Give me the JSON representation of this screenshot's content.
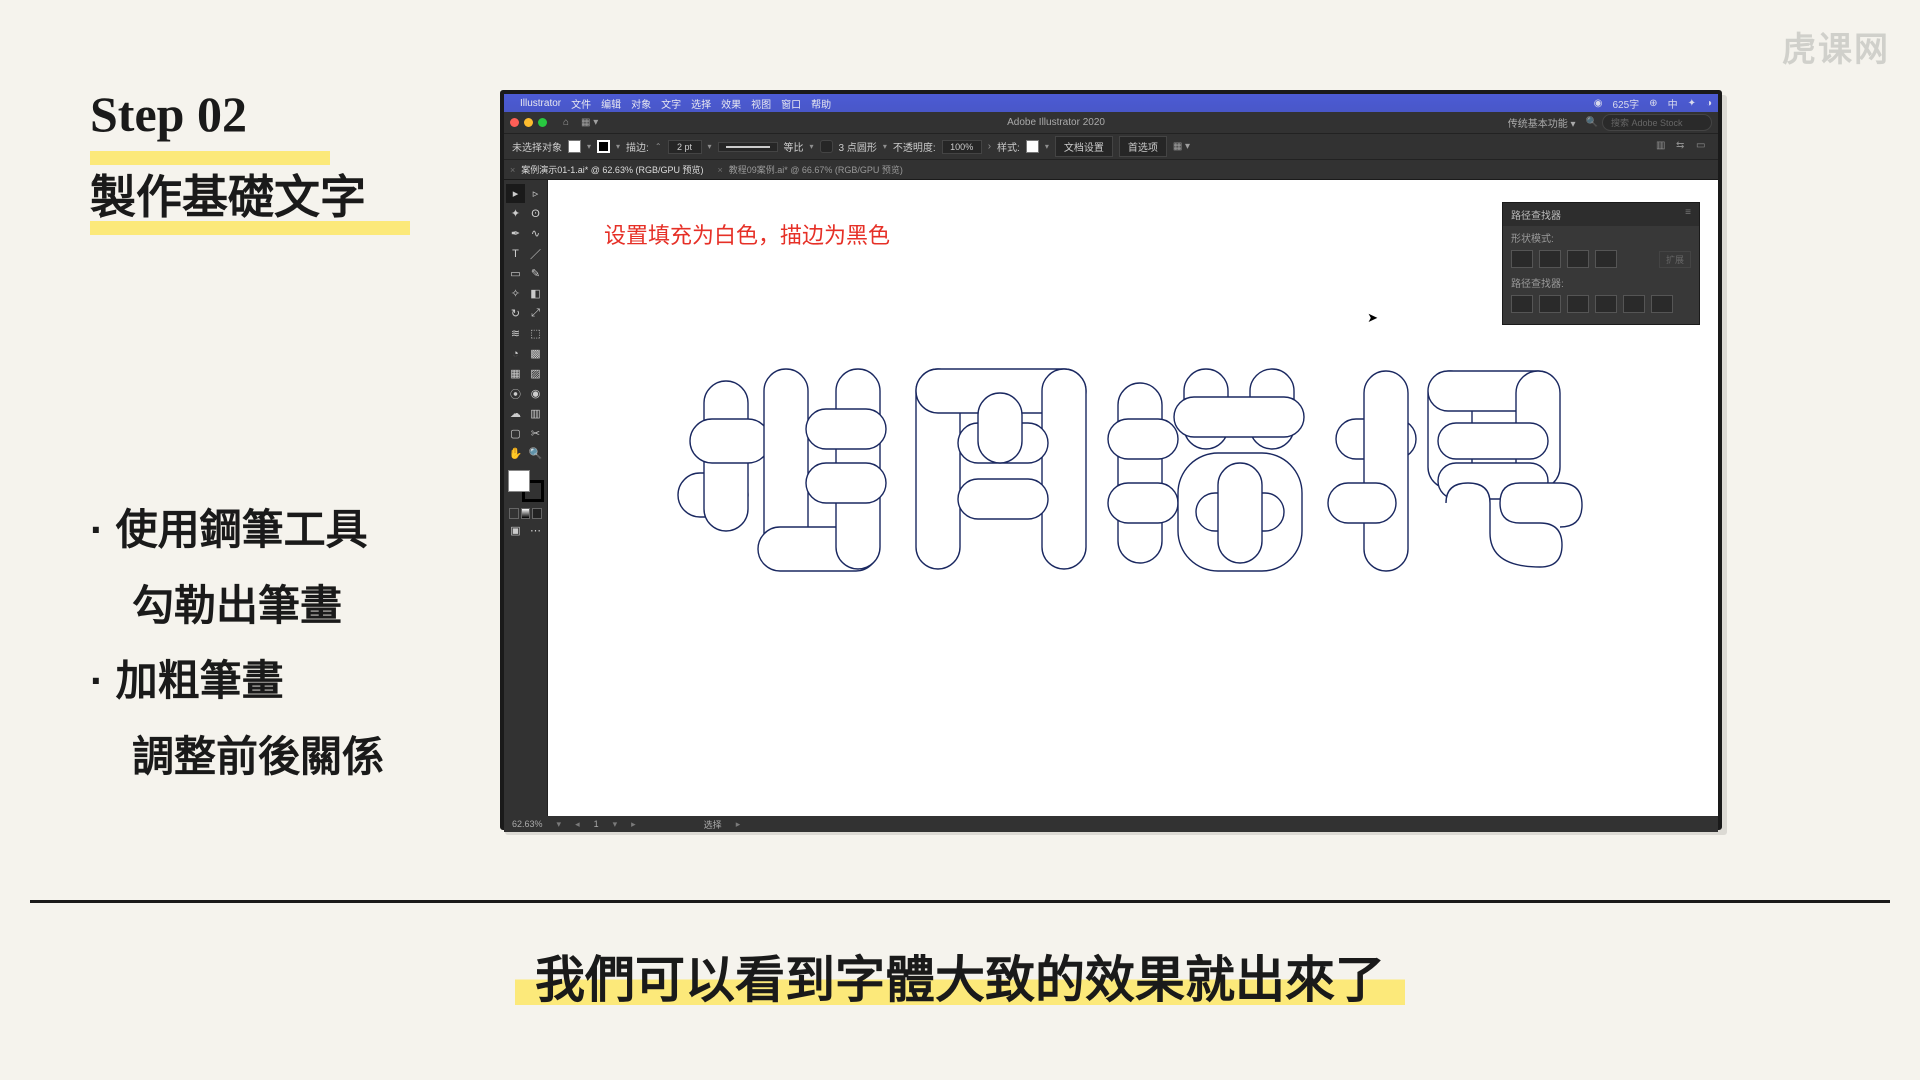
{
  "watermark": "虎课网",
  "step": {
    "num": "Step 02",
    "title": "製作基礎文字"
  },
  "bullets": {
    "b1": "使用鋼筆工具",
    "b1b": "勾勒出筆畫",
    "b2": "加粗筆畫",
    "b2b": "調整前後關係"
  },
  "menubar": {
    "app": "Illustrator",
    "items": [
      "文件",
      "编辑",
      "对象",
      "文字",
      "选择",
      "效果",
      "视图",
      "窗口",
      "帮助"
    ],
    "right_text": "625字"
  },
  "topbar": {
    "title": "Adobe Illustrator 2020",
    "workspace": "传统基本功能",
    "search_ph": "搜索 Adobe Stock"
  },
  "ctrl": {
    "no_sel": "未选择对象",
    "stroke_label": "描边:",
    "stroke_val": "2 pt",
    "uniform": "等比",
    "corner_label": "3 点圆形",
    "opacity_label": "不透明度:",
    "opacity_val": "100%",
    "style_label": "样式:",
    "docsetup": "文档设置",
    "prefs": "首选项"
  },
  "tabs": {
    "t1": "案例演示01-1.ai* @ 62.63% (RGB/GPU 预览)",
    "t2": "教程09案例.ai* @ 66.67% (RGB/GPU 预览)"
  },
  "annotation": "设置填充为白色，描边为黑色",
  "pathfinder": {
    "title": "路径查找器",
    "shape_modes": "形状模式:",
    "expand": "扩展",
    "pathfinders": "路径查找器:"
  },
  "status": {
    "zoom": "62.63%",
    "page": "1",
    "sel": "选择"
  },
  "caption": "我們可以看到字體大致的效果就出來了"
}
